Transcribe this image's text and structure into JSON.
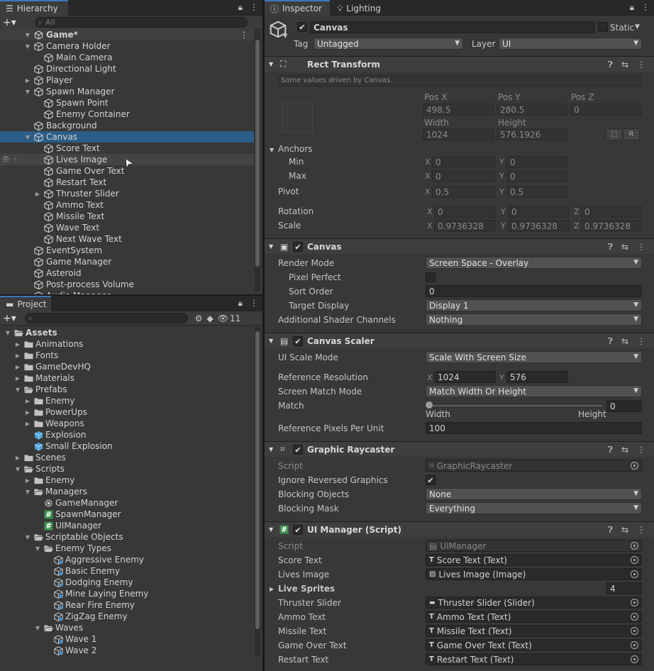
{
  "hierarchy": {
    "tab_label": "Hierarchy",
    "search_placeholder": "All",
    "scene_name": "Game*",
    "items": [
      {
        "label": "Camera Holder"
      },
      {
        "label": "Main Camera"
      },
      {
        "label": "Directional Light"
      },
      {
        "label": "Player"
      },
      {
        "label": "Spawn Manager"
      },
      {
        "label": "Spawn Point"
      },
      {
        "label": "Enemy Container"
      },
      {
        "label": "Background"
      },
      {
        "label": "Canvas"
      },
      {
        "label": "Score Text"
      },
      {
        "label": "Lives Image"
      },
      {
        "label": "Game Over Text"
      },
      {
        "label": "Restart Text"
      },
      {
        "label": "Thruster Slider"
      },
      {
        "label": "Ammo Text"
      },
      {
        "label": "Missile Text"
      },
      {
        "label": "Wave Text"
      },
      {
        "label": "Next Wave Text"
      },
      {
        "label": "EventSystem"
      },
      {
        "label": "Game Manager"
      },
      {
        "label": "Asteroid"
      },
      {
        "label": "Post-process Volume"
      },
      {
        "label": "Audio Manager"
      }
    ]
  },
  "project": {
    "tab_label": "Project",
    "hidden_count": "11",
    "items": [
      {
        "label": "Assets"
      },
      {
        "label": "Animations"
      },
      {
        "label": "Fonts"
      },
      {
        "label": "GameDevHQ"
      },
      {
        "label": "Materials"
      },
      {
        "label": "Prefabs"
      },
      {
        "label": "Enemy"
      },
      {
        "label": "PowerUps"
      },
      {
        "label": "Weapons"
      },
      {
        "label": "Explosion"
      },
      {
        "label": "Small Explosion"
      },
      {
        "label": "Scenes"
      },
      {
        "label": "Scripts"
      },
      {
        "label": "Enemy"
      },
      {
        "label": "Managers"
      },
      {
        "label": "GameManager"
      },
      {
        "label": "SpawnManager"
      },
      {
        "label": "UIManager"
      },
      {
        "label": "Scriptable Objects"
      },
      {
        "label": "Enemy Types"
      },
      {
        "label": "Aggressive Enemy"
      },
      {
        "label": "Basic Enemy"
      },
      {
        "label": "Dodging Enemy"
      },
      {
        "label": "Mine Laying Enemy"
      },
      {
        "label": "Rear Fire Enemy"
      },
      {
        "label": "ZigZag Enemy"
      },
      {
        "label": "Waves"
      },
      {
        "label": "Wave 1"
      },
      {
        "label": "Wave 2"
      }
    ]
  },
  "inspector": {
    "tab_inspector": "Inspector",
    "tab_lighting": "Lighting",
    "object_name": "Canvas",
    "static_label": "Static",
    "tag_label": "Tag",
    "tag_value": "Untagged",
    "layer_label": "Layer",
    "layer_value": "UI",
    "rect": {
      "title": "Rect Transform",
      "note": "Some values driven by Canvas.",
      "posx_label": "Pos X",
      "posy_label": "Pos Y",
      "posz_label": "Pos Z",
      "posx": "498.5",
      "posy": "280.5",
      "posz": "0",
      "width_label": "Width",
      "height_label": "Height",
      "width": "1024",
      "height": "576.1926",
      "r_button": "R",
      "anchors_label": "Anchors",
      "min_label": "Min",
      "max_label": "Max",
      "min_x": "0",
      "min_y": "0",
      "max_x": "0",
      "max_y": "0",
      "pivot_label": "Pivot",
      "pivot_x": "0.5",
      "pivot_y": "0.5",
      "rotation_label": "Rotation",
      "rot_x": "0",
      "rot_y": "0",
      "rot_z": "0",
      "scale_label": "Scale",
      "scale_x": "0.9736328",
      "scale_y": "0.9736328",
      "scale_z": "0.9736328",
      "x": "X",
      "y": "Y",
      "z": "Z"
    },
    "canvas": {
      "title": "Canvas",
      "render_mode_label": "Render Mode",
      "render_mode": "Screen Space - Overlay",
      "pixel_perfect_label": "Pixel Perfect",
      "sort_order_label": "Sort Order",
      "sort_order": "0",
      "target_display_label": "Target Display",
      "target_display": "Display 1",
      "shader_channels_label": "Additional Shader Channels",
      "shader_channels": "Nothing"
    },
    "scaler": {
      "title": "Canvas Scaler",
      "scale_mode_label": "UI Scale Mode",
      "scale_mode": "Scale With Screen Size",
      "ref_res_label": "Reference Resolution",
      "ref_x": "1024",
      "ref_y": "576",
      "match_mode_label": "Screen Match Mode",
      "match_mode": "Match Width Or Height",
      "match_label": "Match",
      "match_value": "0",
      "match_fraction": 0,
      "width_word": "Width",
      "height_word": "Height",
      "ppu_label": "Reference Pixels Per Unit",
      "ppu": "100"
    },
    "raycaster": {
      "title": "Graphic Raycaster",
      "script_label": "Script",
      "script": "GraphicRaycaster",
      "ignore_label": "Ignore Reversed Graphics",
      "blocking_objects_label": "Blocking Objects",
      "blocking_objects": "None",
      "blocking_mask_label": "Blocking Mask",
      "blocking_mask": "Everything"
    },
    "uimanager": {
      "title": "UI Manager (Script)",
      "script_label": "Script",
      "script": "UIManager",
      "score_label": "Score Text",
      "score": "Score Text (Text)",
      "lives_label": "Lives Image",
      "lives": "Lives Image (Image)",
      "sprites_label": "Live Sprites",
      "sprites_count": "4",
      "thruster_label": "Thruster Slider",
      "thruster": "Thruster Slider (Slider)",
      "ammo_label": "Ammo Text",
      "ammo": "Ammo Text (Text)",
      "missile_label": "Missile Text",
      "missile": "Missile Text (Text)",
      "gameover_label": "Game Over Text",
      "gameover": "Game Over Text (Text)",
      "restart_label": "Restart Text",
      "restart": "Restart Text (Text)"
    }
  },
  "colors": {
    "selection": "#2c5d87",
    "tab_accent": "#3a79bb",
    "panel": "#383838"
  }
}
